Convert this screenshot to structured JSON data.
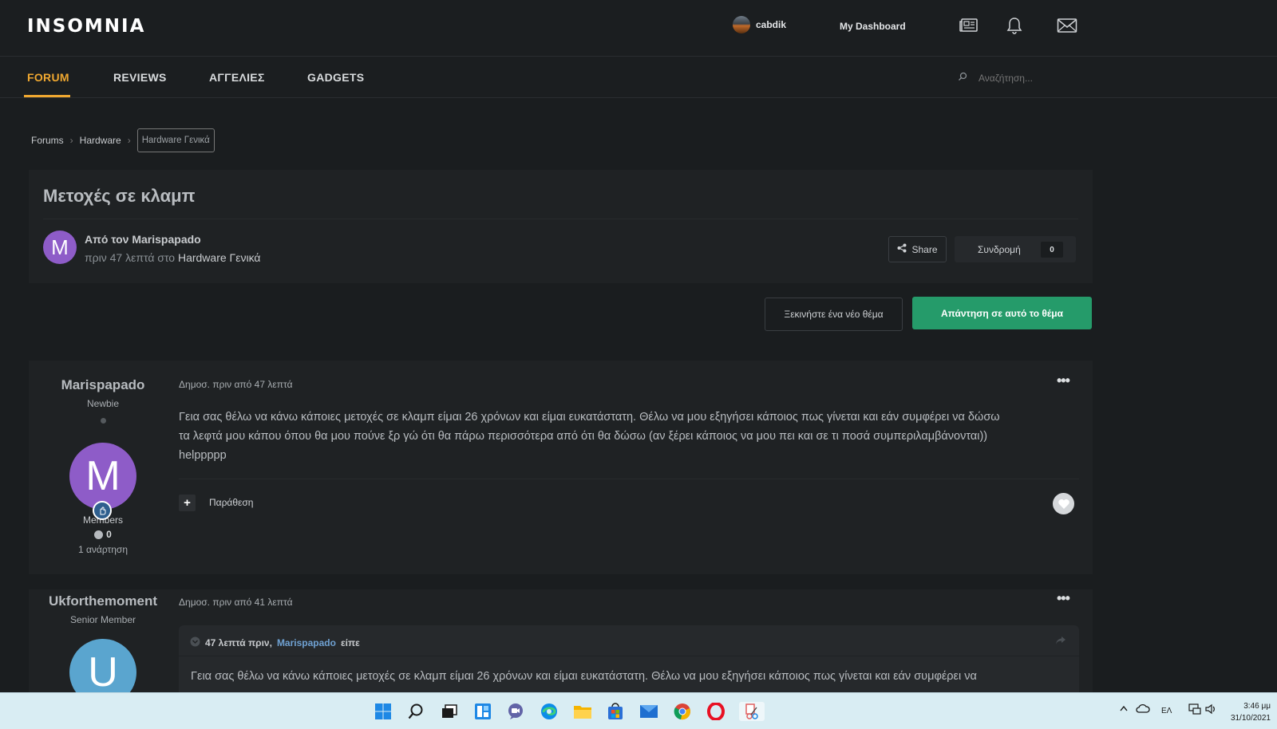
{
  "header": {
    "logo": "INSOMNIA",
    "username": "cabdik",
    "dashboard_label": "My Dashboard",
    "icons": [
      "news-icon",
      "bell-icon",
      "mail-icon"
    ]
  },
  "nav": {
    "items": [
      "FORUM",
      "REVIEWS",
      "ΑΓΓΕΛΙΕΣ",
      "GADGETS"
    ],
    "active": "FORUM",
    "search_placeholder": "Αναζήτηση..."
  },
  "breadcrumb": [
    "Forums",
    "Hardware",
    "Hardware Γενικά"
  ],
  "topic": {
    "title": "Μετοχές σε κλαμπ",
    "author_initial": "M",
    "author_line": "Από τον Marispapado",
    "time_prefix": "πριν 47 λεπτά στο",
    "forum": "Hardware Γενικά",
    "share_label": "Share",
    "follow_label": "Συνδρομή",
    "follow_count": "0"
  },
  "actions": {
    "start_topic": "Ξεκινήστε ένα νέο θέμα",
    "reply": "Απάντηση σε αυτό το θέμα"
  },
  "posts": [
    {
      "author": "Marispapado",
      "rank": "Newbie",
      "avatar_initial": "M",
      "avatar_color": "#8e5cc8",
      "group": "Members",
      "reputation": "0",
      "post_count": "1 ανάρτηση",
      "date": "Δημοσ. πριν από 47 λεπτά",
      "body_lines": [
        "Γεια σας θέλω να κάνω κάποιες μετοχές σε κλαμπ είμαι 26 χρόνων και είμαι ευκατάστατη. Θέλω να μου εξηγήσει κάποιος πως γίνεται και εάν συμφέρει να δώσω",
        "τα λεφτά μου κάπου όπου θα μου πούνε ξρ γώ ότι θα πάρω περισσότερα από ότι θα δώσω (αν ξέρει κάποιος να μου πει και σε τι ποσά συμπεριλαμβάνονται))",
        "helppppp"
      ],
      "quote_label": "Παράθεση"
    },
    {
      "author": "Ukforthemoment",
      "rank": "Senior Member",
      "avatar_initial": "U",
      "avatar_color": "#5aa5cf",
      "date": "Δημοσ. πριν από 41 λεπτά",
      "quote_time": "47 λεπτά πριν,",
      "quote_author": "Marispapado",
      "quote_said": "είπε",
      "quote_text": "Γεια σας θέλω να κάνω κάποιες μετοχές σε κλαμπ είμαι 26 χρόνων και είμαι ευκατάστατη. Θέλω να μου εξηγήσει κάποιος πως γίνεται και εάν συμφέρει να"
    }
  ],
  "taskbar": {
    "apps": [
      "windows-start-icon",
      "search-icon",
      "task-view-icon",
      "widgets-icon",
      "teams-chat-icon",
      "edge-icon",
      "file-explorer-icon",
      "store-icon",
      "mail-icon",
      "chrome-icon",
      "opera-icon",
      "snipping-tool-icon"
    ],
    "language": "ΕΛ",
    "time": "3:46 μμ",
    "date": "31/10/2021"
  }
}
